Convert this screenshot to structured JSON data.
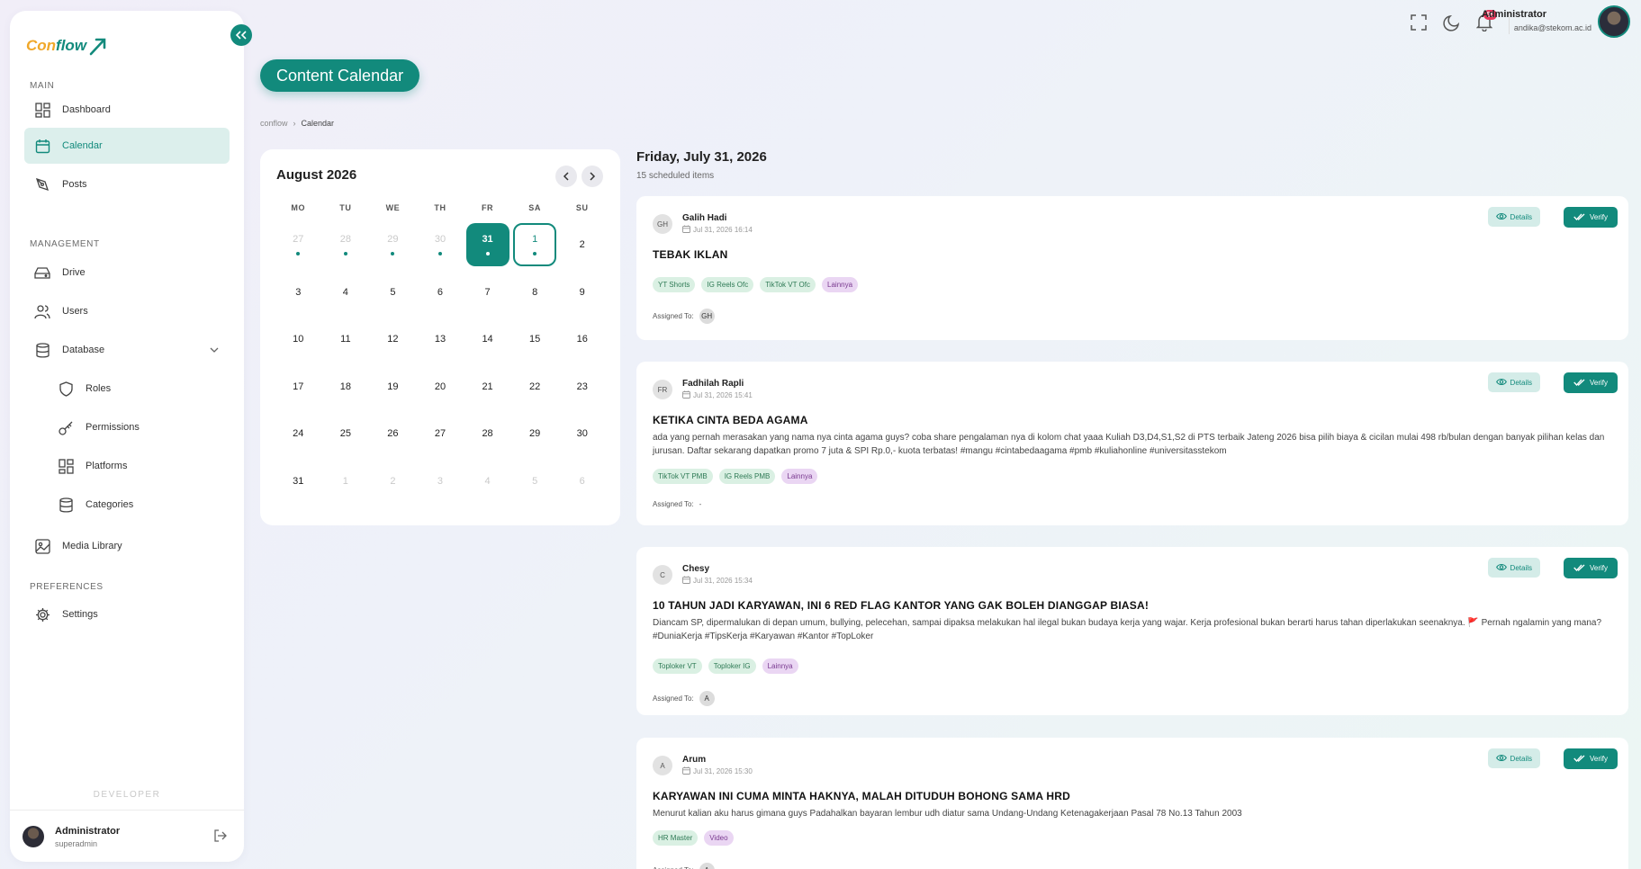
{
  "brand": {
    "part1": "Con",
    "part2": "flow"
  },
  "sidebar": {
    "sections": {
      "main": "MAIN",
      "management": "MANAGEMENT",
      "preferences": "PREFERENCES"
    },
    "items": [
      {
        "label": "Dashboard",
        "icon": "grid-icon"
      },
      {
        "label": "Calendar",
        "icon": "calendar-icon",
        "active": true
      },
      {
        "label": "Posts",
        "icon": "pen-tool-icon"
      },
      {
        "label": "Drive",
        "icon": "hard-drive-icon"
      },
      {
        "label": "Users",
        "icon": "users-icon"
      },
      {
        "label": "Database",
        "icon": "database-icon"
      },
      {
        "label": "Roles",
        "icon": "shield-icon"
      },
      {
        "label": "Permissions",
        "icon": "key-icon"
      },
      {
        "label": "Platforms",
        "icon": "layout-icon"
      },
      {
        "label": "Categories",
        "icon": "database-icon"
      },
      {
        "label": "Media Library",
        "icon": "image-icon"
      },
      {
        "label": "Settings",
        "icon": "gear-icon"
      }
    ],
    "developer_label": "DEVELOPER",
    "footer": {
      "name": "Administrator",
      "role": "superadmin"
    }
  },
  "topbar": {
    "notification_count": "65",
    "user_name": "Administrator",
    "user_email": "andika@stekom.ac.id"
  },
  "page": {
    "title": "Content Calendar",
    "breadcrumb": [
      "conflow",
      "Calendar"
    ]
  },
  "calendar": {
    "month_label": "August 2026",
    "weekdays": [
      "MO",
      "TU",
      "WE",
      "TH",
      "FR",
      "SA",
      "SU"
    ],
    "days": [
      {
        "n": "27",
        "muted": true,
        "dot": true
      },
      {
        "n": "28",
        "muted": true,
        "dot": true
      },
      {
        "n": "29",
        "muted": true,
        "dot": true
      },
      {
        "n": "30",
        "muted": true,
        "dot": true
      },
      {
        "n": "31",
        "selected": true,
        "dot": true
      },
      {
        "n": "1",
        "today": true,
        "dot": true
      },
      {
        "n": "2"
      },
      {
        "n": "3"
      },
      {
        "n": "4"
      },
      {
        "n": "5"
      },
      {
        "n": "6"
      },
      {
        "n": "7"
      },
      {
        "n": "8"
      },
      {
        "n": "9"
      },
      {
        "n": "10"
      },
      {
        "n": "11"
      },
      {
        "n": "12"
      },
      {
        "n": "13"
      },
      {
        "n": "14"
      },
      {
        "n": "15"
      },
      {
        "n": "16"
      },
      {
        "n": "17"
      },
      {
        "n": "18"
      },
      {
        "n": "19"
      },
      {
        "n": "20"
      },
      {
        "n": "21"
      },
      {
        "n": "22"
      },
      {
        "n": "23"
      },
      {
        "n": "24"
      },
      {
        "n": "25"
      },
      {
        "n": "26"
      },
      {
        "n": "27"
      },
      {
        "n": "28"
      },
      {
        "n": "29"
      },
      {
        "n": "30"
      },
      {
        "n": "31"
      },
      {
        "n": "1",
        "muted": true
      },
      {
        "n": "2",
        "muted": true
      },
      {
        "n": "3",
        "muted": true
      },
      {
        "n": "4",
        "muted": true
      },
      {
        "n": "5",
        "muted": true
      },
      {
        "n": "6",
        "muted": true
      }
    ]
  },
  "schedule": {
    "date_label": "Friday, July 31, 2026",
    "count_label": "15 scheduled items",
    "assigned_label": "Assigned To:",
    "details_label": "Details",
    "verify_label": "Verify",
    "posts": [
      {
        "initials": "GH",
        "author": "Galih Hadi",
        "datetime": "Jul 31, 2026 16:14",
        "title": "TEBAK IKLAN",
        "body": "",
        "tags": [
          {
            "t": "YT Shorts"
          },
          {
            "t": "IG Reels Ofc"
          },
          {
            "t": "TikTok VT Ofc"
          },
          {
            "t": "Lainnya",
            "purple": true
          }
        ],
        "assigned": "GH"
      },
      {
        "initials": "FR",
        "author": "Fadhilah Rapli",
        "datetime": "Jul 31, 2026 15:41",
        "title": "KETIKA CINTA BEDA AGAMA",
        "body": "ada yang pernah merasakan yang nama nya cinta agama guys? coba share pengalaman nya di kolom chat yaaa Kuliah D3,D4,S1,S2 di PTS terbaik Jateng 2026 bisa pilih biaya & cicilan mulai 498 rb/bulan dengan banyak pilihan kelas dan jurusan. Daftar sekarang dapatkan promo 7 juta & SPI Rp.0,- kuota terbatas! #mangu #cintabedaagama #pmb #kuliahonline #universitasstekom",
        "tags": [
          {
            "t": "TikTok VT PMB"
          },
          {
            "t": "IG Reels PMB"
          },
          {
            "t": "Lainnya",
            "purple": true
          }
        ],
        "assigned": "-"
      },
      {
        "initials": "C",
        "author": "Chesy",
        "datetime": "Jul 31, 2026 15:34",
        "title": "10 TAHUN JADI KARYAWAN, INI 6 RED FLAG KANTOR YANG GAK BOLEH DIANGGAP BIASA!",
        "body": "Diancam SP, dipermalukan di depan umum, bullying, pelecehan, sampai dipaksa melakukan hal ilegal bukan budaya kerja yang wajar. Kerja profesional bukan berarti harus tahan diperlakukan seenaknya. 🚩 Pernah ngalamin yang mana? #DuniaKerja #TipsKerja #Karyawan #Kantor #TopLoker",
        "tags": [
          {
            "t": "Toploker VT"
          },
          {
            "t": "Toploker IG"
          },
          {
            "t": "Lainnya",
            "purple": true
          }
        ],
        "assigned": "A"
      },
      {
        "initials": "A",
        "author": "Arum",
        "datetime": "Jul 31, 2026 15:30",
        "title": "KARYAWAN INI CUMA MINTA HAKNYA, MALAH DITUDUH BOHONG SAMA HRD",
        "body": "Menurut kalian aku harus gimana guys Padahalkan bayaran lembur udh diatur sama Undang-Undang Ketenagakerjaan Pasal 78 No.13 Tahun 2003",
        "tags": [
          {
            "t": "HR Master"
          },
          {
            "t": "Video",
            "purple": true
          }
        ],
        "assigned": "A"
      }
    ]
  }
}
